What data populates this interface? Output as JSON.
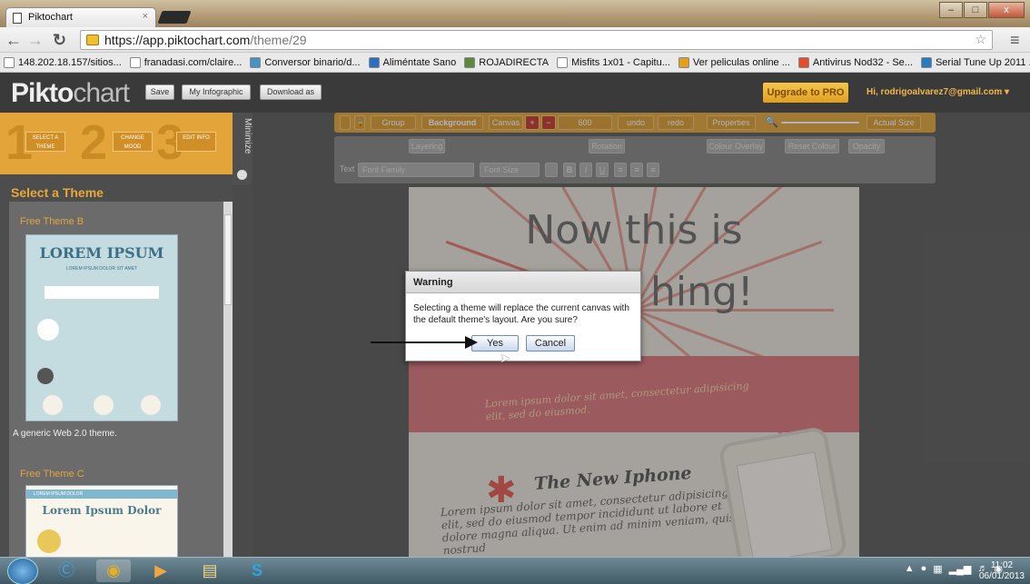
{
  "browser": {
    "tab_title": "Piktochart",
    "tab_close": "×",
    "url_host": "https://app.piktochart.com",
    "url_path": "/theme/29",
    "window_min": "–",
    "window_max": "□",
    "window_close": "x"
  },
  "bookmarks": [
    {
      "label": "148.202.18.157/sitios...",
      "color": "#ffffff"
    },
    {
      "label": "franadasi.com/claire...",
      "color": "#ffffff"
    },
    {
      "label": "Conversor binario/d...",
      "color": "#4a90c0"
    },
    {
      "label": "Aliméntate Sano",
      "color": "#2b6fc0"
    },
    {
      "label": "ROJADIRECTA",
      "color": "#5a8a3a"
    },
    {
      "label": "Misfits 1x01 - Capitu...",
      "color": "#ffffff"
    },
    {
      "label": "Ver peliculas online ...",
      "color": "#e0a020"
    },
    {
      "label": "Antivirus Nod32 - Se...",
      "color": "#e05030"
    },
    {
      "label": "Serial Tune Up 2011 ...",
      "color": "#2a7ac0"
    }
  ],
  "app": {
    "logo_bold": "Pikto",
    "logo_light": "chart",
    "save": "Save",
    "my_infographic": "My Infographic",
    "download": "Download as",
    "upgrade": "Upgrade to PRO",
    "greeting": "Hi, rodrigoalvarez7@gmail.com ▾"
  },
  "sidebar": {
    "steps": [
      {
        "num": "1",
        "label": "SELECT A THEME"
      },
      {
        "num": "2",
        "label": "CHANGE MOOD"
      },
      {
        "num": "3",
        "label": "EDIT INFO"
      }
    ],
    "minimize": "Minimize",
    "heading": "Select a Theme",
    "themes": [
      {
        "title": "Free Theme B",
        "card_title": "LOREM IPSUM",
        "card_sub": "LOREM IPSUM DOLOR SIT AMET",
        "desc": "A generic Web 2.0 theme."
      },
      {
        "title": "Free Theme C",
        "card_title": "Lorem Ipsum Dolor",
        "card_sub": "LOREM IPSUM DOLOR"
      }
    ]
  },
  "toolbar": {
    "group": "Group",
    "background": "Background",
    "canvas": "Canvas",
    "canvas_value": "600",
    "undo": "undo",
    "redo": "redo",
    "properties": "Properties",
    "actual_size": "Actual Size",
    "layering": "Layering",
    "rotation": "Rotation",
    "colour_overlay": "Colour Overlay",
    "reset_colour": "Reset Colour",
    "opacity": "Opacity",
    "text": "Text",
    "font_family": "Font Family",
    "font_size": "Font Size"
  },
  "canvas": {
    "headline_line1": "Now this is",
    "headline_line2": "hing!",
    "banner_text": "Lorem ipsum dolor sit amet, consectetur adipisicing elit, sed do eiusmod.",
    "section_title": "The New Iphone",
    "body_text": "Lorem ipsum dolor sit amet, consectetur adipisicing elit, sed do eiusmod tempor incididunt ut labore et dolore magna aliqua. Ut enim ad minim veniam, quis nostrud"
  },
  "dialog": {
    "title": "Warning",
    "message": "Selecting a theme will replace the current canvas with the default theme's layout. Are you sure?",
    "yes": "Yes",
    "cancel": "Cancel"
  },
  "taskbar": {
    "time": "11:02",
    "date": "06/01/2013"
  }
}
